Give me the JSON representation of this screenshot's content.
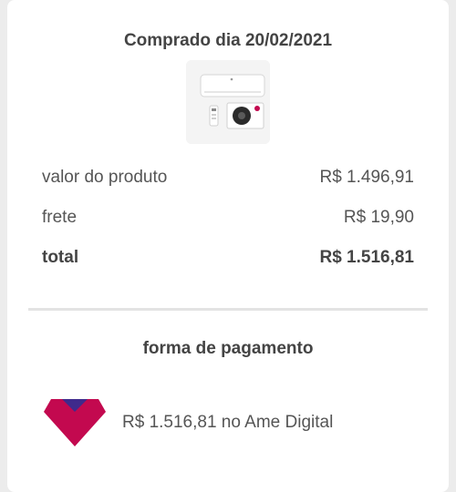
{
  "order": {
    "purchased_label": "Comprado dia 20/02/2021",
    "product_image_icon": "air-conditioner-product-image"
  },
  "summary": {
    "rows": [
      {
        "label": "valor do produto",
        "value": "R$ 1.496,91"
      },
      {
        "label": "frete",
        "value": "R$ 19,90"
      },
      {
        "label": "total",
        "value": "R$ 1.516,81"
      }
    ]
  },
  "payment": {
    "title": "forma de pagamento",
    "method_text": "R$ 1.516,81 no Ame Digital",
    "logo_icon": "ame-digital-logo-icon",
    "logo_colors": {
      "primary": "#c3094f",
      "accent": "#3f2a8c"
    }
  }
}
